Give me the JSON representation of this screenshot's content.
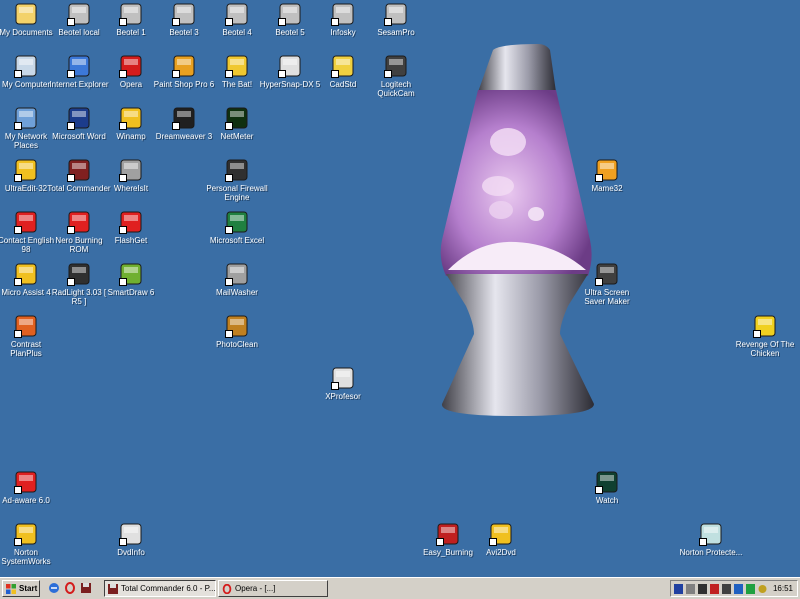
{
  "desktop": {
    "icons": [
      {
        "label": "My Documents",
        "icon": "folder-documents-icon",
        "color": "#f3d26a"
      },
      {
        "label": "Beotel local",
        "icon": "network-computer-icon",
        "color": "#c0c0c0"
      },
      {
        "label": "Beotel 1",
        "icon": "network-computer-icon",
        "color": "#c0c0c0"
      },
      {
        "label": "Beotel 3",
        "icon": "network-computer-icon",
        "color": "#c0c0c0"
      },
      {
        "label": "Beotel 4",
        "icon": "network-computer-icon",
        "color": "#c0c0c0"
      },
      {
        "label": "Beotel 5",
        "icon": "network-computer-icon",
        "color": "#c0c0c0"
      },
      {
        "label": "Infosky",
        "icon": "network-computer-icon",
        "color": "#c0c0c0"
      },
      {
        "label": "SesamPro",
        "icon": "network-computer-icon",
        "color": "#c0c0c0"
      },
      {
        "label": "My Computer",
        "icon": "my-computer-icon",
        "color": "#c8d8e8"
      },
      {
        "label": "Internet Explorer",
        "icon": "internet-explorer-icon",
        "color": "#3c78d8"
      },
      {
        "label": "Opera",
        "icon": "opera-icon",
        "color": "#d41c1c"
      },
      {
        "label": "Paint Shop Pro 6",
        "icon": "paint-shop-pro-icon",
        "color": "#e8a020"
      },
      {
        "label": "The Bat!",
        "icon": "the-bat-icon",
        "color": "#f0c830"
      },
      {
        "label": "HyperSnap-DX 5",
        "icon": "hypersnap-icon",
        "color": "#e0e0e0"
      },
      {
        "label": "CadStd",
        "icon": "cadstd-icon",
        "color": "#f0d040"
      },
      {
        "label": "Logitech QuickCam",
        "icon": "webcam-icon",
        "color": "#404040"
      },
      {
        "label": "My Network Places",
        "icon": "network-places-icon",
        "color": "#6fa0d8"
      },
      {
        "label": "Microsoft Word",
        "icon": "microsoft-word-icon",
        "color": "#1c3c8c"
      },
      {
        "label": "Winamp",
        "icon": "winamp-icon",
        "color": "#f0c020"
      },
      {
        "label": "Dreamweaver 3",
        "icon": "dreamweaver-icon",
        "color": "#202020"
      },
      {
        "label": "NetMeter",
        "icon": "netmeter-icon",
        "color": "#103010"
      },
      {
        "label": "UltraEdit-32",
        "icon": "ultraedit-icon",
        "color": "#f0c020"
      },
      {
        "label": "Total Commander",
        "icon": "floppy-disk-icon",
        "color": "#802020"
      },
      {
        "label": "WhereIsIt",
        "icon": "whereisit-icon",
        "color": "#a0a0a0"
      },
      {
        "label": "Personal Firewall Engine",
        "icon": "firewall-icon",
        "color": "#303030"
      },
      {
        "label": "Contact English 98",
        "icon": "contact-english-icon",
        "color": "#e02020"
      },
      {
        "label": "Nero Burning ROM",
        "icon": "nero-icon",
        "color": "#e02020"
      },
      {
        "label": "FlashGet",
        "icon": "flashget-icon",
        "color": "#e02020"
      },
      {
        "label": "Microsoft Excel",
        "icon": "microsoft-excel-icon",
        "color": "#208040"
      },
      {
        "label": "Micro Assist 4",
        "icon": "micro-assist-icon",
        "color": "#f0c020"
      },
      {
        "label": "RadLight 3.03 [ R5 ]",
        "icon": "film-icon",
        "color": "#303030"
      },
      {
        "label": "SmartDraw 6",
        "icon": "smartdraw-icon",
        "color": "#70b030"
      },
      {
        "label": "MailWasher",
        "icon": "mailwasher-icon",
        "color": "#a0a0a0"
      },
      {
        "label": "Contrast PlanPlus",
        "icon": "planplus-icon",
        "color": "#e06020"
      },
      {
        "label": "PhotoClean",
        "icon": "photoclean-icon",
        "color": "#c08020"
      },
      {
        "label": "XProfesor",
        "icon": "application-window-icon",
        "color": "#e0e0e0"
      },
      {
        "label": "Mame32",
        "icon": "mame32-icon",
        "color": "#f0a020"
      },
      {
        "label": "Ultra Screen Saver Maker",
        "icon": "screensaver-icon",
        "color": "#404040"
      },
      {
        "label": "Revenge Of The Chicken",
        "icon": "chicken-icon",
        "color": "#f0d020"
      },
      {
        "label": "Ad-aware 6.0",
        "icon": "ad-aware-icon",
        "color": "#e02020"
      },
      {
        "label": "Watch",
        "icon": "watch-icon",
        "color": "#104030"
      },
      {
        "label": "Norton SystemWorks",
        "icon": "norton-systemworks-icon",
        "color": "#f0c020"
      },
      {
        "label": "DvdInfo",
        "icon": "dvdinfo-icon",
        "color": "#e0e0e0"
      },
      {
        "label": "Easy_Burning",
        "icon": "easy-burning-icon",
        "color": "#c02020"
      },
      {
        "label": "Avi2Dvd",
        "icon": "avi2dvd-icon",
        "color": "#f0c020"
      },
      {
        "label": "Norton Protecte...",
        "icon": "recycle-bin-icon",
        "color": "#c0e0e0"
      }
    ]
  },
  "wallpaper": {
    "name": "lava-lamp",
    "glass_color": "#c79ad8",
    "metal_color": "#9a9aa8"
  },
  "taskbar": {
    "start_label": "Start",
    "quick_launch": [
      "internet-explorer-icon",
      "opera-icon",
      "total-commander-icon"
    ],
    "windows": [
      {
        "label": "Total Commander 6.0 - P...",
        "active": true,
        "icon": "floppy-disk-icon"
      },
      {
        "label": "Opera - [...]",
        "active": false,
        "icon": "opera-icon"
      }
    ],
    "tray": [
      "tray-icon-1",
      "tray-icon-2",
      "tray-icon-3",
      "tray-icon-4",
      "tray-icon-5",
      "tray-icon-6",
      "tray-icon-7",
      "tray-icon-8"
    ],
    "clock": "16:51"
  }
}
